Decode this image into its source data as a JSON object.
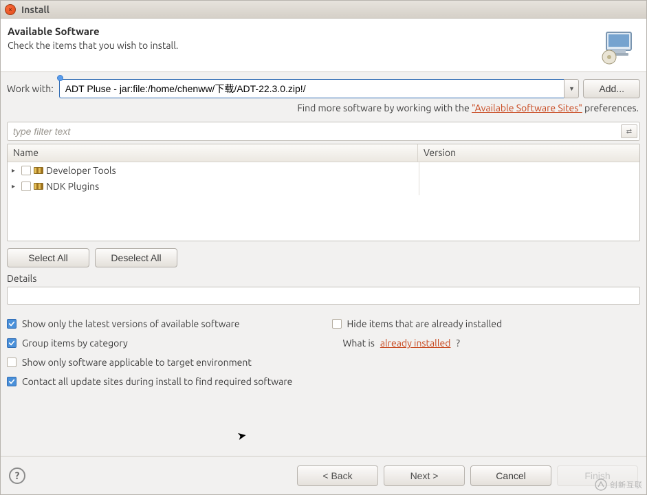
{
  "window": {
    "title": "Install"
  },
  "header": {
    "heading": "Available Software",
    "subheading": "Check the items that you wish to install."
  },
  "workwith": {
    "label": "Work with:",
    "value": "ADT Pluse - jar:file:/home/chenww/下载/ADT-22.3.0.zip!/",
    "add_label": "Add..."
  },
  "hint": {
    "prefix": "Find more software by working with the ",
    "link": "\"Available Software Sites\"",
    "suffix": " preferences."
  },
  "filter": {
    "placeholder": "type filter text",
    "toggle_glyph": "⇄"
  },
  "tree": {
    "columns": {
      "name": "Name",
      "version": "Version"
    },
    "items": [
      {
        "label": "Developer Tools"
      },
      {
        "label": "NDK Plugins"
      }
    ]
  },
  "buttons": {
    "select_all": "Select All",
    "deselect_all": "Deselect All"
  },
  "details": {
    "label": "Details"
  },
  "options": {
    "show_latest": "Show only the latest versions of available software",
    "group_by_category": "Group items by category",
    "show_applicable": "Show only software applicable to target environment",
    "contact_sites": "Contact all update sites during install to find required software",
    "hide_installed": "Hide items that are already installed",
    "whatis_prefix": "What is ",
    "whatis_link": "already installed",
    "whatis_suffix": "?"
  },
  "footer": {
    "back": "< Back",
    "next": "Next >",
    "cancel": "Cancel",
    "finish": "Finish"
  },
  "watermark": {
    "text": "创新互联"
  }
}
